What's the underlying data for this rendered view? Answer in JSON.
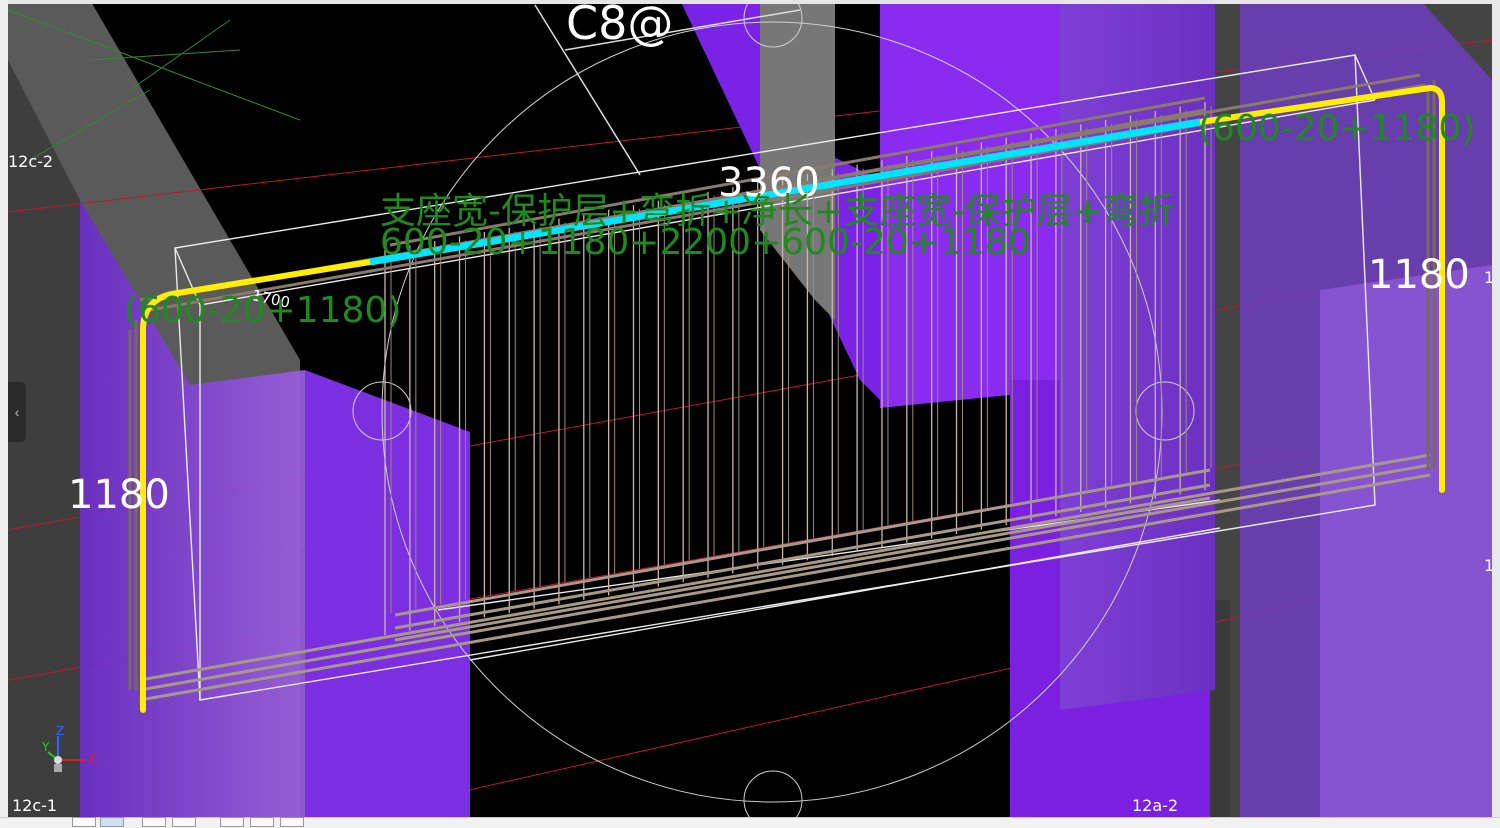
{
  "viewport": {
    "rebar_spec": "C8@",
    "dim_top": "3360",
    "dim_small": "1700",
    "dim_left": "1180",
    "dim_right": "1180",
    "formula_text": "支座宽-保护层+弯折+净长+支座宽-保护层+弯折",
    "formula_values": "600-20+1180+2200+600-20+1180",
    "left_segment": "(600-20+1180)",
    "right_segment": "(600-20+1180)",
    "grid_12c2": "12c-2",
    "grid_12c1": "12c-1",
    "grid_12a2": "12a-2",
    "edge_mark": "1",
    "axis_z": "Z",
    "axis_y": "Y",
    "axis_x": "X"
  },
  "ui": {
    "collapse_arrow": "‹"
  },
  "colors": {
    "background": "#000000",
    "column_purple": "#7b1fe0",
    "transparent_purple": "#8a4fd0",
    "highlight_yellow": "#ffee00",
    "highlight_cyan": "#00e5ff",
    "formula_green": "#1f8a1f",
    "stirrup": "#c8b8a8"
  }
}
